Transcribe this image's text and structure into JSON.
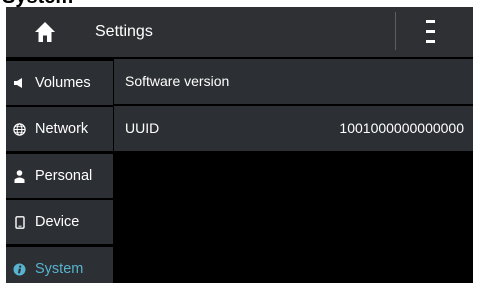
{
  "page": {
    "heading": "System"
  },
  "header": {
    "title": "Settings"
  },
  "sidebar": {
    "items": [
      {
        "label": "Volumes"
      },
      {
        "label": "Network"
      },
      {
        "label": "Personal"
      },
      {
        "label": "Device"
      },
      {
        "label": "System"
      }
    ],
    "active_color": "#57b3cf"
  },
  "content": {
    "rows": [
      {
        "label": "Software version",
        "value": ""
      },
      {
        "label": "UUID",
        "value": "1001000000000000"
      }
    ]
  },
  "colors": {
    "header_bg": "#2e3033",
    "panel_bg": "#2c2f33",
    "background": "#000000",
    "accent": "#57b3cf"
  },
  "icons": {
    "header": [
      "home-icon",
      "menu-icon"
    ],
    "sidebar": [
      "speaker-icon",
      "globe-icon",
      "person-icon",
      "phone-icon",
      "info-icon"
    ]
  }
}
